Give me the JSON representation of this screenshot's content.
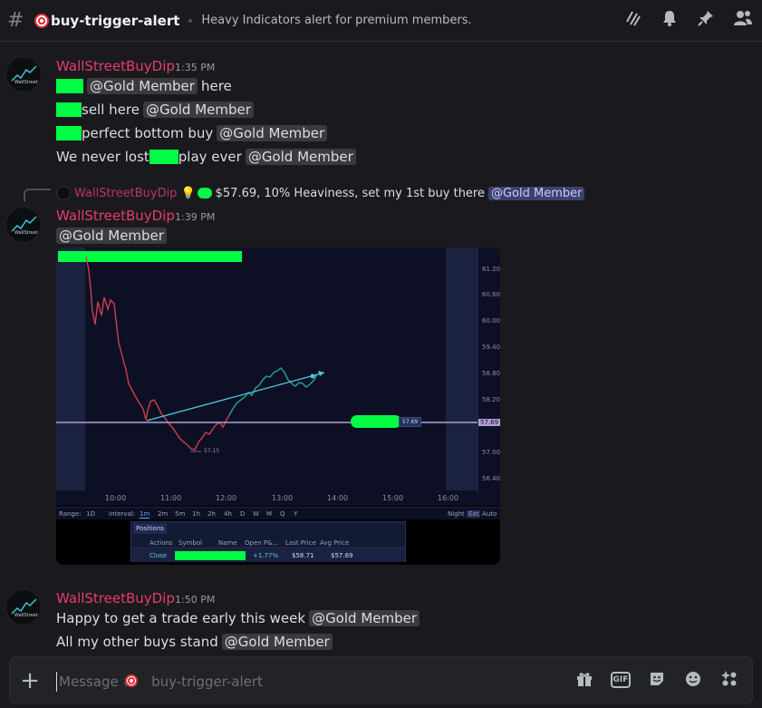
{
  "header": {
    "channel_name": "buy-trigger-alert",
    "topic": "Heavy Indicators alert for premium members."
  },
  "icons": {
    "header": [
      "threads-icon",
      "bell-icon",
      "pin-icon",
      "members-icon"
    ],
    "composer": [
      "gift-icon",
      "gif-icon",
      "sticker-icon",
      "emoji-icon",
      "apps-icon"
    ]
  },
  "messages": [
    {
      "author": "WallStreetBuyDip",
      "time": "1:35 PM",
      "lines": [
        {
          "text": "here",
          "mention": "@Gold Member"
        },
        {
          "text": "sell here",
          "mention": "@Gold Member"
        },
        {
          "text": "perfect bottom buy",
          "mention": "@Gold Member"
        },
        {
          "text_before": "We never lost",
          "text_after": "play ever",
          "mention": "@Gold Member"
        }
      ]
    },
    {
      "reply": {
        "author": "WallStreetBuyDip",
        "text": "$57.69, 10% Heaviness, set my 1st buy there",
        "mention": "@Gold Member"
      },
      "author": "WallStreetBuyDip",
      "time": "1:39 PM",
      "mention": "@Gold Member"
    },
    {
      "author": "WallStreetBuyDip",
      "time": "1:50 PM",
      "lines": [
        {
          "text": "Happy to get a trade early this week",
          "mention": "@Gold Member"
        },
        {
          "text": "All my other buys stand",
          "mention": "@Gold Member"
        }
      ]
    }
  ],
  "chart": {
    "y_ticks": [
      "61.20",
      "60.60",
      "60.00",
      "59.40",
      "58.80",
      "58.20",
      "57.69",
      "57.00",
      "56.40"
    ],
    "x_ticks": [
      "10:00",
      "11:00",
      "12:00",
      "13:00",
      "14:00",
      "15:00",
      "16:00"
    ],
    "low_label": "57.15",
    "order_label": "57.69",
    "toolbar": {
      "range_label": "Range:",
      "range_value": "1D",
      "interval_label": "Interval:",
      "intervals": [
        "1m",
        "2m",
        "5m",
        "1h",
        "2h",
        "4h",
        "D",
        "W",
        "M",
        "Q",
        "Y"
      ],
      "night": "Night",
      "ext": "Ext",
      "auto": "Auto"
    },
    "positions": {
      "tab": "Positions",
      "columns": [
        "Actions",
        "Symbol",
        "Name",
        "Open P&...",
        "Last Price",
        "Avg Price"
      ],
      "row": {
        "action": "Close",
        "open_pl": "+1.77%",
        "last_price": "$58.71",
        "avg_price": "$57.69"
      }
    }
  },
  "composer": {
    "placeholder": "Message #    buy-trigger-alert"
  }
}
